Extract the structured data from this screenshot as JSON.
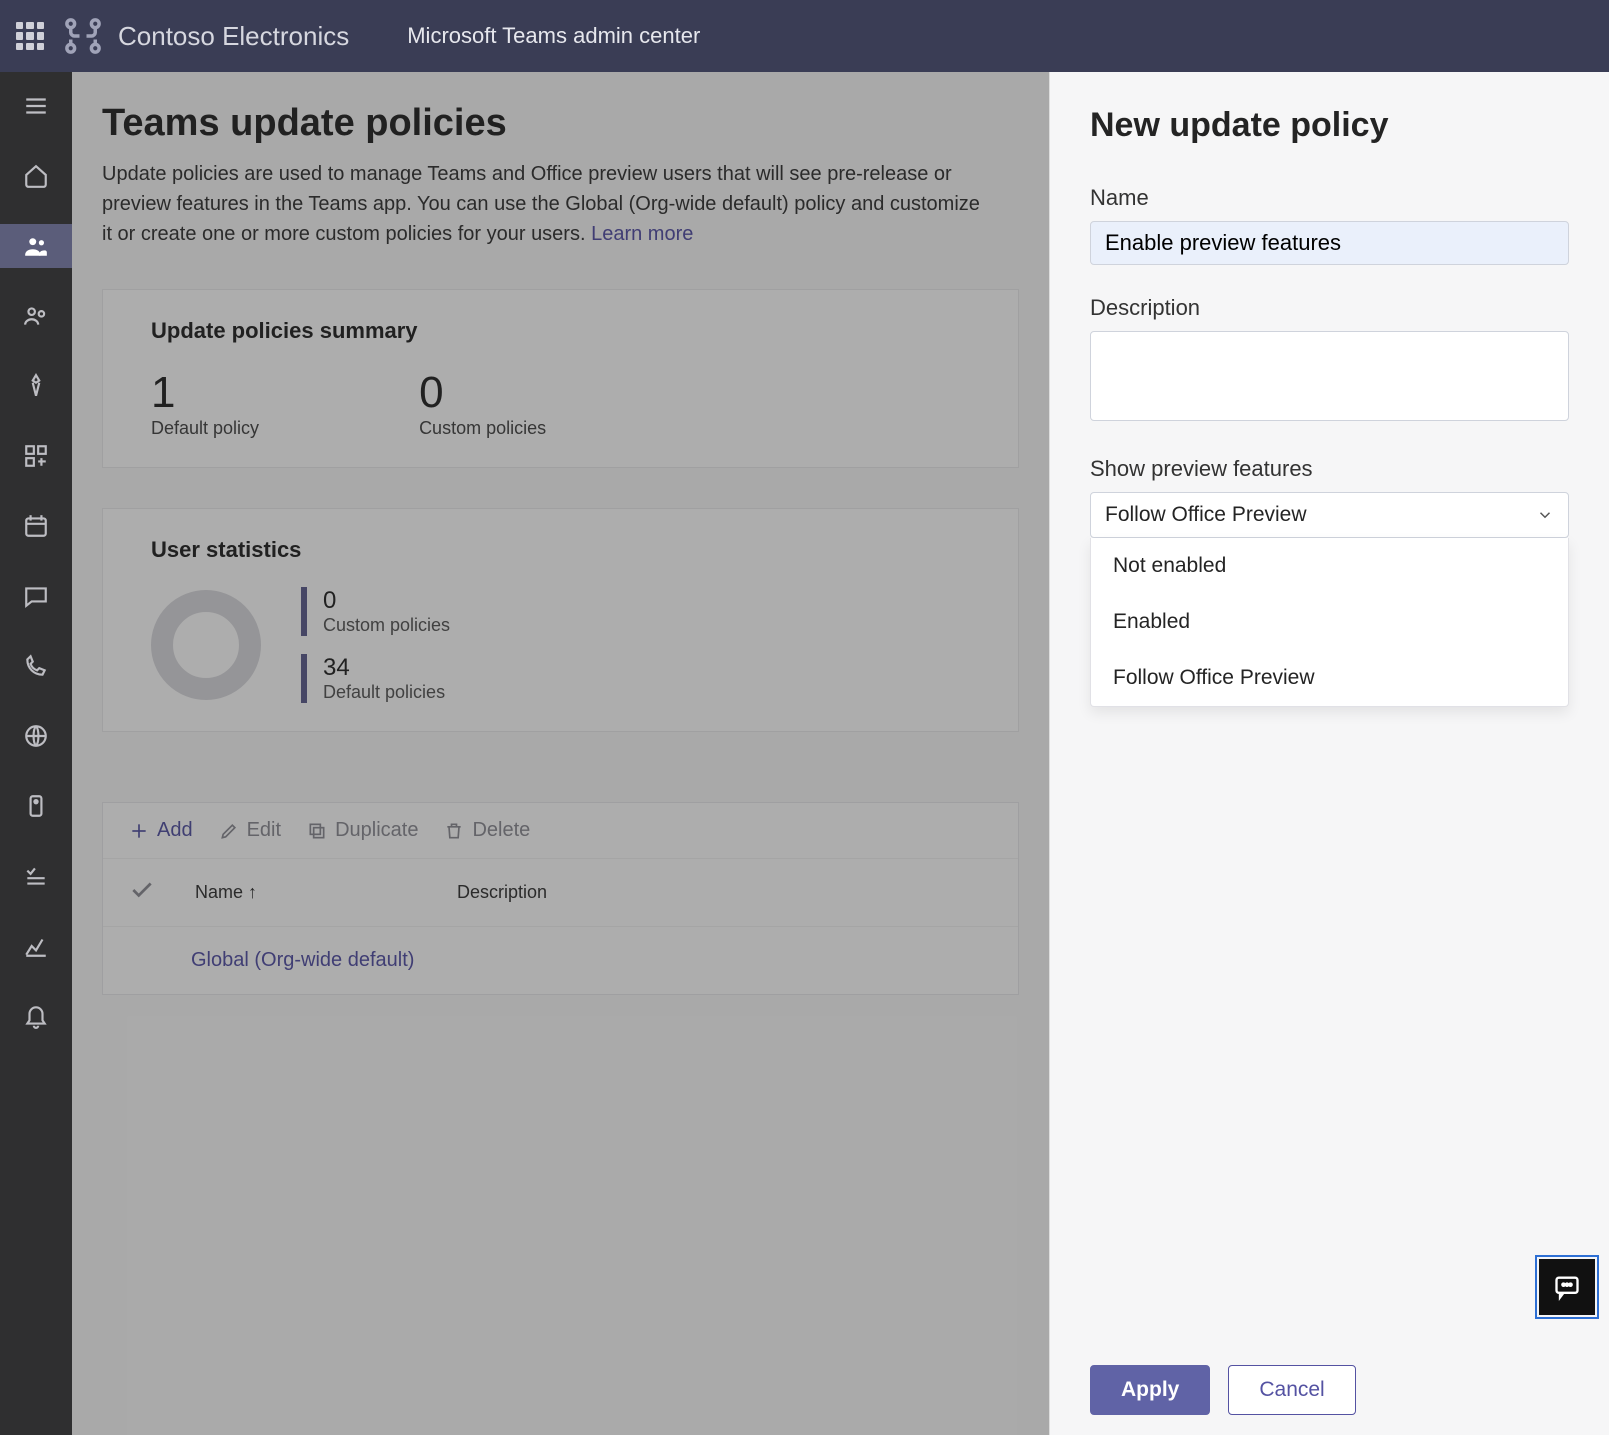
{
  "header": {
    "brand_name": "Contoso Electronics",
    "app_title": "Microsoft Teams admin center"
  },
  "nav": {
    "items": [
      {
        "icon": "menu"
      },
      {
        "icon": "home"
      },
      {
        "icon": "teams",
        "active": true
      },
      {
        "icon": "people"
      },
      {
        "icon": "rocket"
      },
      {
        "icon": "apps"
      },
      {
        "icon": "calendar"
      },
      {
        "icon": "message"
      },
      {
        "icon": "phone"
      },
      {
        "icon": "globe"
      },
      {
        "icon": "policy"
      },
      {
        "icon": "checklist"
      },
      {
        "icon": "analytics"
      },
      {
        "icon": "bell"
      }
    ]
  },
  "page": {
    "title": "Teams update policies",
    "description_prefix": "Update policies are used to manage Teams and Office preview users that will see pre-release or preview features in the Teams app. You can use the Global (Org-wide default) policy and customize it or create one or more custom policies for your users. ",
    "learn_more": "Learn more"
  },
  "summary": {
    "title": "Update policies summary",
    "default_count": "1",
    "default_label": "Default policy",
    "custom_count": "0",
    "custom_label": "Custom policies"
  },
  "user_stats": {
    "title": "User statistics",
    "custom_count": "0",
    "custom_label": "Custom policies",
    "default_count": "34",
    "default_label": "Default policies"
  },
  "toolbar": {
    "add": "Add",
    "edit": "Edit",
    "duplicate": "Duplicate",
    "delete": "Delete"
  },
  "table": {
    "col_name": "Name ↑",
    "col_desc": "Description",
    "row0_name": "Global (Org-wide default)"
  },
  "panel": {
    "title": "New update policy",
    "name_label": "Name",
    "name_value": "Enable preview features",
    "desc_label": "Description",
    "desc_value": "",
    "preview_label": "Show preview features",
    "preview_selected": "Follow Office Preview",
    "preview_options": {
      "o0": "Not enabled",
      "o1": "Enabled",
      "o2": "Follow Office Preview"
    },
    "apply": "Apply",
    "cancel": "Cancel"
  }
}
